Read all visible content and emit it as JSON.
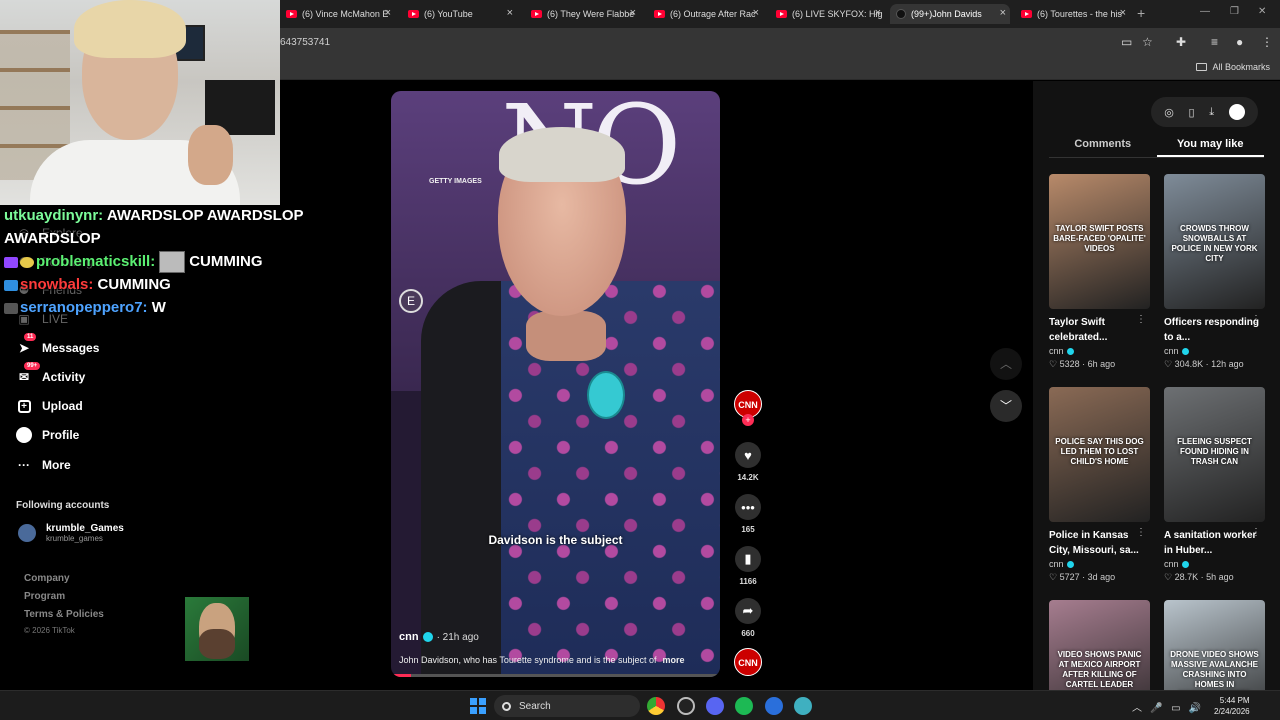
{
  "browser": {
    "tabs": [
      {
        "label": "(6) Vince McMahon E",
        "icon": "youtube-icon"
      },
      {
        "label": "(6) YouTube",
        "icon": "youtube-icon"
      },
      {
        "label": "(6) They Were Flabbe",
        "icon": "youtube-icon"
      },
      {
        "label": "(6) Outrage After Rac",
        "icon": "youtube-icon"
      },
      {
        "label": "(6) LIVE SKYFOX: Hig",
        "icon": "youtube-icon"
      },
      {
        "label": "(99+)John Davids",
        "icon": "tiktok-icon",
        "active": true
      },
      {
        "label": "(6) Tourettes - the his",
        "icon": "youtube-icon"
      }
    ],
    "url": "643753741",
    "bookmarks_label": "All Bookmarks"
  },
  "chat": [
    {
      "user": "utkuaydinynr:",
      "user_color": "#7CFC9A",
      "message": "AWARDSLOP AWARDSLOP AWARDSLOP"
    },
    {
      "user": "problematicskill:",
      "user_color": "#5BF072",
      "message": "CUMMING",
      "has_emote": true
    },
    {
      "user": "snowbals:",
      "user_color": "#FF3B3B",
      "message": "CUMMING"
    },
    {
      "user": "serranopeppero7:",
      "user_color": "#4EA3FF",
      "message": "W"
    }
  ],
  "sidebar": {
    "faded_items": [
      "Explore",
      "Following",
      "Friends",
      "LIVE"
    ],
    "items": [
      {
        "label": "Messages",
        "icon": "message-icon",
        "badge": "11"
      },
      {
        "label": "Activity",
        "icon": "inbox-icon",
        "badge": "99+"
      },
      {
        "label": "Upload",
        "icon": "upload-icon"
      },
      {
        "label": "Profile",
        "icon": "profile-icon"
      },
      {
        "label": "More",
        "icon": "more-icon"
      }
    ],
    "following_title": "Following accounts",
    "account": {
      "name": "krumble_Games",
      "handle": "krumble_games"
    },
    "footer": [
      "Company",
      "Program",
      "Terms & Policies"
    ],
    "copyright": "© 2026 TikTok"
  },
  "video": {
    "getty": "GETTY IMAGES",
    "backdrop_letters": "NO E",
    "e_badge": "E",
    "caption": "Davidson is the subject",
    "author": "cnn",
    "time_ago": "· 21h ago",
    "description": "John Davidson, who has Tourette syndrome and is the subject of",
    "more": "more",
    "progress": 0.06
  },
  "actions": {
    "channel": "CNN",
    "likes": "14.2K",
    "comments": "165",
    "saves": "1166",
    "shares": "660",
    "sound": "CNN"
  },
  "right_panel": {
    "tabs": [
      "Comments",
      "You may like"
    ],
    "active_tab": "You may like",
    "cards": [
      {
        "overlay": "TAYLOR SWIFT POSTS BARE-FACED 'OPALITE' VIDEOS",
        "title": "Taylor Swift celebrated...",
        "channel": "cnn",
        "views": "5328",
        "age": "6h ago",
        "bg": "#b88a6a"
      },
      {
        "overlay": "CROWDS THROW SNOWBALLS AT POLICE IN NEW YORK CITY",
        "title": "Officers responding to a...",
        "channel": "cnn",
        "views": "304.8K",
        "age": "12h ago",
        "bg": "#7f8c99"
      },
      {
        "overlay": "POLICE SAY THIS DOG LED THEM TO LOST CHILD'S HOME",
        "title": "Police in Kansas City, Missouri, sa...",
        "channel": "cnn",
        "views": "5727",
        "age": "3d ago",
        "bg": "#8a6a55"
      },
      {
        "overlay": "FLEEING SUSPECT FOUND HIDING IN TRASH CAN",
        "title": "A sanitation worker in Huber...",
        "channel": "cnn",
        "views": "28.7K",
        "age": "5h ago",
        "bg": "#6d7073"
      },
      {
        "overlay": "VIDEO SHOWS PANIC AT MEXICO AIRPORT AFTER KILLING OF CARTEL LEADER",
        "bg": "#a67d8f"
      },
      {
        "overlay": "DRONE VIDEO SHOWS MASSIVE AVALANCHE CRASHING INTO HOMES IN MASSACHUSETTS",
        "bg": "#b9c4cc"
      }
    ]
  },
  "taskbar": {
    "search": "Search",
    "time": "5:44 PM",
    "date": "2/24/2026"
  }
}
